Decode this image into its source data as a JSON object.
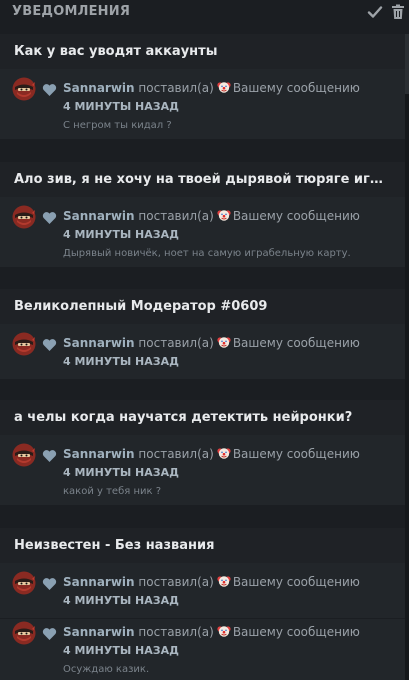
{
  "header": {
    "title": "УВЕДОМЛЕНИЯ",
    "mark_read_icon": "check-icon",
    "clear_icon": "trash-icon"
  },
  "groups": [
    {
      "title": "Как у вас уводят аккаунты",
      "items": [
        {
          "user": "Sannarwin",
          "action": "поставил(а)",
          "target": "Вашему сообщению",
          "time": "4 МИНУТЫ НАЗАД",
          "message": "С негром ты кидал ?"
        }
      ]
    },
    {
      "title": "Ало зив, я не хочу на твоей дырявой тюряге играть, дай...",
      "items": [
        {
          "user": "Sannarwin",
          "action": "поставил(а)",
          "target": "Вашему сообщению",
          "time": "4 МИНУТЫ НАЗАД",
          "message": "Дырявый новичёк, ноет на самую играбельную карту."
        }
      ]
    },
    {
      "title": "Великолепный Модератор #0609",
      "items": [
        {
          "user": "Sannarwin",
          "action": "поставил(а)",
          "target": "Вашему сообщению",
          "time": "4 МИНУТЫ НАЗАД",
          "message": ""
        }
      ]
    },
    {
      "title": "а челы когда научатся детектить нейронки?",
      "items": [
        {
          "user": "Sannarwin",
          "action": "поставил(а)",
          "target": "Вашему сообщению",
          "time": "4 МИНУТЫ НАЗАД",
          "message": "какой у тебя ник ?"
        }
      ]
    },
    {
      "title": "Неизвестен - Без названия",
      "items": [
        {
          "user": "Sannarwin",
          "action": "поставил(а)",
          "target": "Вашему сообщению",
          "time": "4 МИНУТЫ НАЗАД",
          "message": ""
        },
        {
          "user": "Sannarwin",
          "action": "поставил(а)",
          "target": "Вашему сообщению",
          "time": "4 МИНУТЫ НАЗАД",
          "message": "Осуждаю казик."
        }
      ]
    }
  ],
  "icons": {
    "avatar": "ninja-avatar-icon",
    "reaction_type": "heart-icon",
    "reaction_emoji": "clown-icon"
  },
  "colors": {
    "background": "#1b1e22",
    "item_background": "#22262a",
    "group_background": "#1f2226",
    "username": "#9fb0bd",
    "heart": "#8aa0b2"
  }
}
